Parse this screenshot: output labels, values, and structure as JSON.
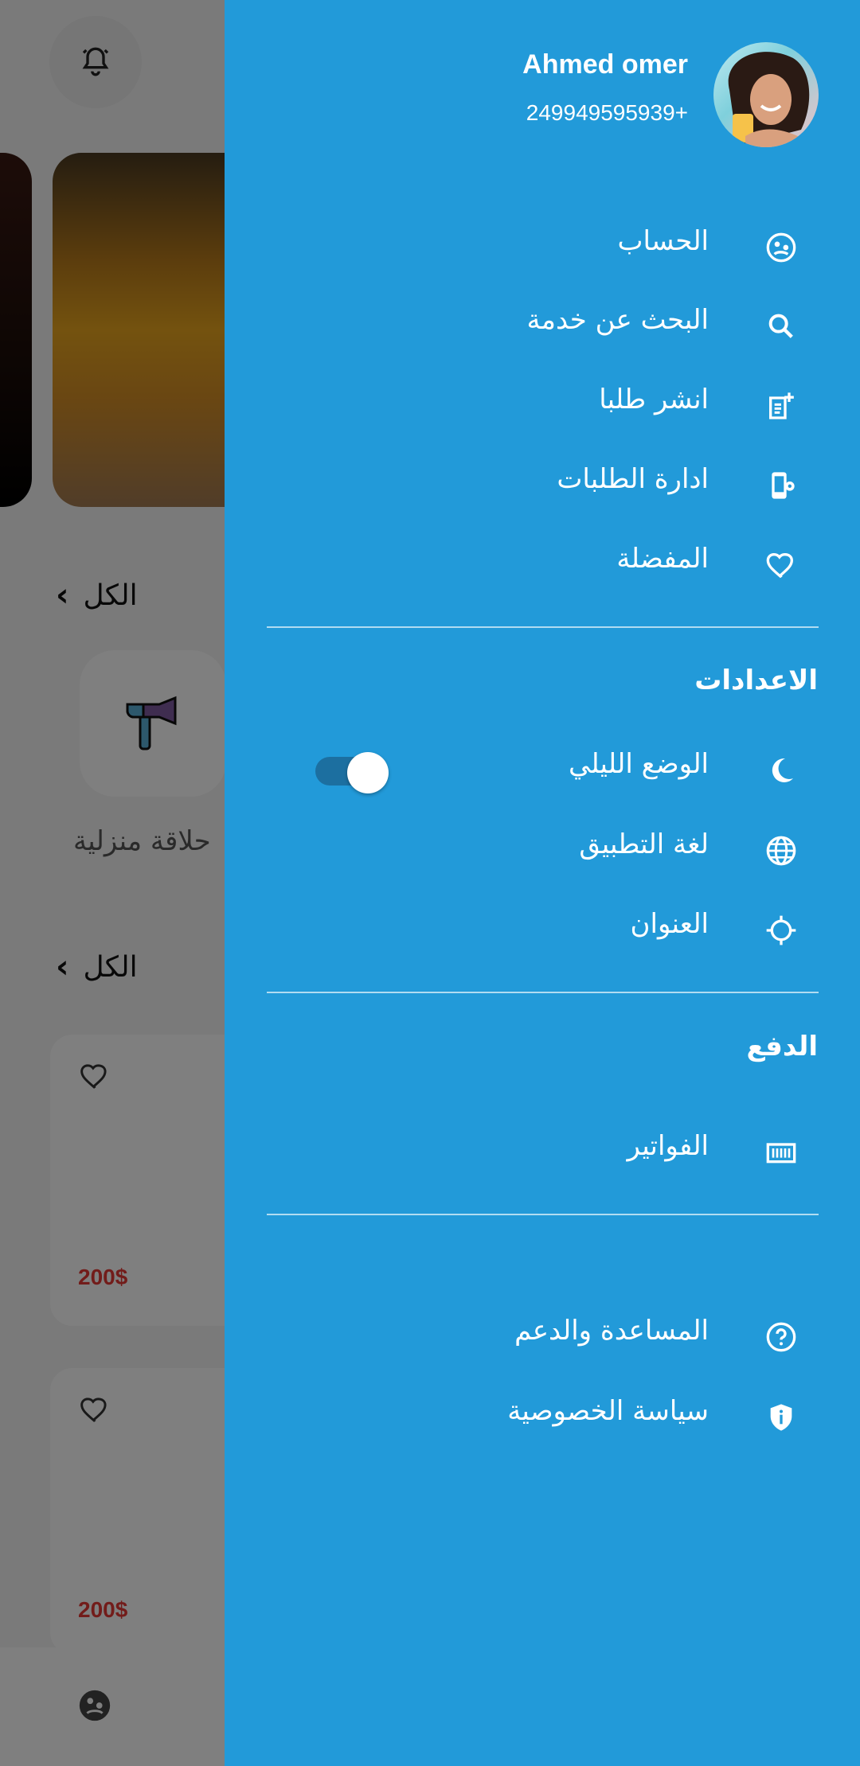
{
  "background": {
    "all_label_1": "الكل",
    "all_label_2": "الكل",
    "category_label": "حلاقة منزلية",
    "card_price_1": "200$",
    "card_price_2": "200$"
  },
  "drawer": {
    "profile": {
      "name": "Ahmed omer",
      "phone": "249949595939+"
    },
    "menu": [
      {
        "label": "الحساب",
        "icon": "account-icon"
      },
      {
        "label": "البحث عن خدمة",
        "icon": "search-icon"
      },
      {
        "label": "انشر طلبا",
        "icon": "post-request-icon"
      },
      {
        "label": "ادارة الطلبات",
        "icon": "manage-requests-icon"
      },
      {
        "label": "المفضلة",
        "icon": "heart-icon"
      }
    ],
    "settings": {
      "title": "الاعدادات",
      "items": [
        {
          "label": "الوضع الليلي",
          "icon": "moon-icon",
          "toggle_on": true
        },
        {
          "label": "لغة التطبيق",
          "icon": "globe-icon"
        },
        {
          "label": "العنوان",
          "icon": "location-icon"
        }
      ]
    },
    "payment": {
      "title": "الدفع",
      "items": [
        {
          "label": "الفواتير",
          "icon": "invoice-icon"
        }
      ]
    },
    "support": [
      {
        "label": "المساعدة والدعم",
        "icon": "help-icon"
      },
      {
        "label": "سياسة الخصوصية",
        "icon": "privacy-icon"
      }
    ]
  },
  "colors": {
    "drawer": "#229ad9",
    "price": "#e53935"
  }
}
